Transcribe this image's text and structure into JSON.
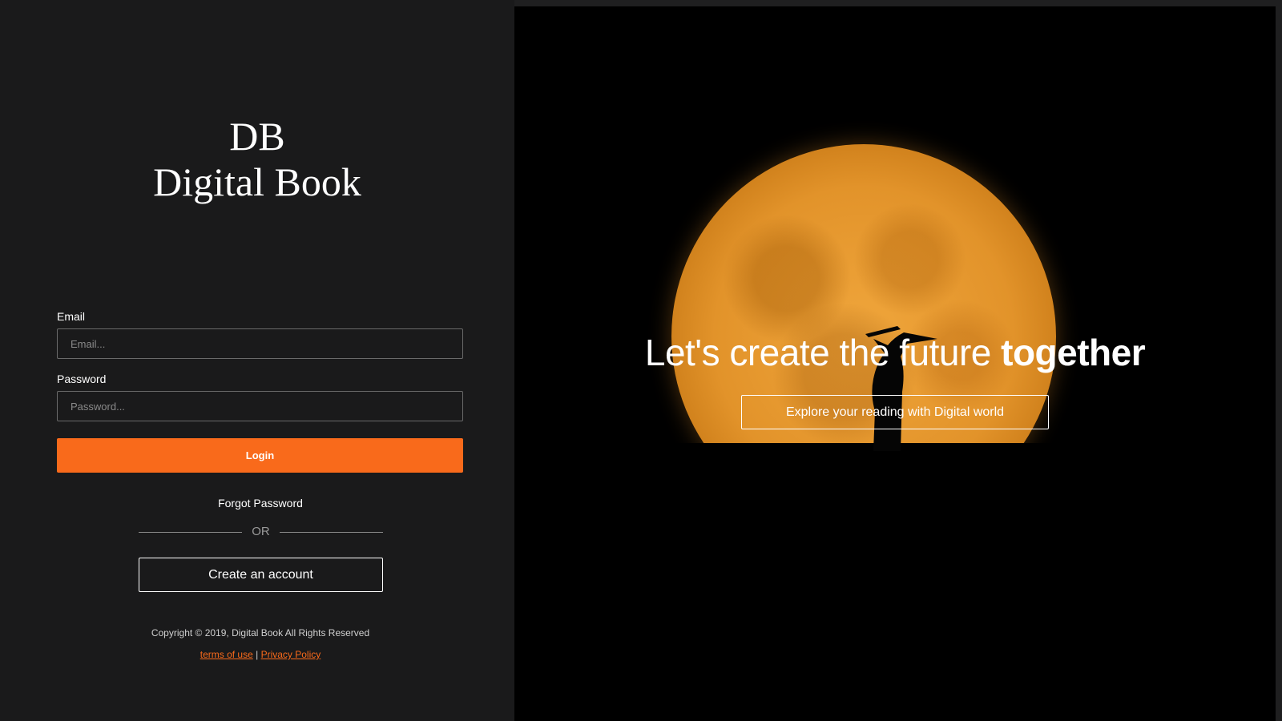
{
  "brand": {
    "abbreviation": "DB",
    "name": "Digital Book"
  },
  "login_form": {
    "email_label": "Email",
    "email_placeholder": "Email...",
    "email_value": "",
    "password_label": "Password",
    "password_placeholder": "Password...",
    "password_value": "",
    "login_button": "Login",
    "forgot_password": "Forgot Password",
    "separator": "OR",
    "create_account_button": "Create an account"
  },
  "footer": {
    "copyright": "Copyright © 2019, Digital Book All Rights Reserved",
    "terms_link": "terms of use",
    "divider": " | ",
    "privacy_link": "Privacy Policy"
  },
  "hero": {
    "headline_regular": "Let's create the future ",
    "headline_bold": "together",
    "explore_button": "Explore your reading with Digital world",
    "image": "full-moon-with-silhouette"
  },
  "colors": {
    "accent": "#f96a1b",
    "background": "#1a1a1b",
    "hero_background": "#000000",
    "text": "#ffffff"
  }
}
